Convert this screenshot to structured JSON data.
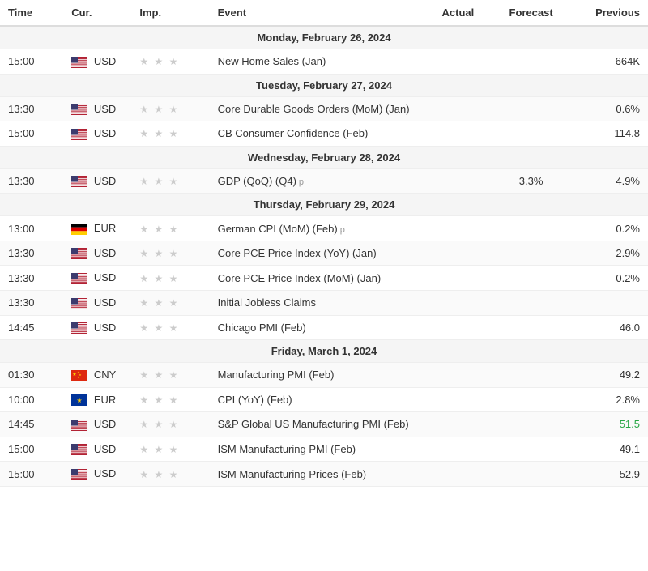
{
  "header": {
    "columns": [
      "Time",
      "Cur.",
      "Imp.",
      "Event",
      "Actual",
      "Forecast",
      "Previous"
    ]
  },
  "days": [
    {
      "label": "Monday, February 26, 2024",
      "rows": [
        {
          "time": "15:00",
          "currency": "USD",
          "flag": "us",
          "stars": "★ ★ ★",
          "event": "New Home Sales (Jan)",
          "actual": "",
          "forecast": "",
          "previous": "664K",
          "previous_green": false,
          "preliminary": false
        }
      ]
    },
    {
      "label": "Tuesday, February 27, 2024",
      "rows": [
        {
          "time": "13:30",
          "currency": "USD",
          "flag": "us",
          "stars": "★ ★ ★",
          "event": "Core Durable Goods Orders (MoM) (Jan)",
          "actual": "",
          "forecast": "",
          "previous": "0.6%",
          "previous_green": false,
          "preliminary": false
        },
        {
          "time": "15:00",
          "currency": "USD",
          "flag": "us",
          "stars": "★ ★ ★",
          "event": "CB Consumer Confidence (Feb)",
          "actual": "",
          "forecast": "",
          "previous": "114.8",
          "previous_green": false,
          "preliminary": false
        }
      ]
    },
    {
      "label": "Wednesday, February 28, 2024",
      "rows": [
        {
          "time": "13:30",
          "currency": "USD",
          "flag": "us",
          "stars": "★ ★ ★",
          "event": "GDP (QoQ) (Q4)",
          "actual": "",
          "forecast": "3.3%",
          "previous": "4.9%",
          "previous_green": false,
          "preliminary": true
        }
      ]
    },
    {
      "label": "Thursday, February 29, 2024",
      "rows": [
        {
          "time": "13:00",
          "currency": "EUR",
          "flag": "de",
          "stars": "★ ★ ★",
          "event": "German CPI (MoM) (Feb)",
          "actual": "",
          "forecast": "",
          "previous": "0.2%",
          "previous_green": false,
          "preliminary": true
        },
        {
          "time": "13:30",
          "currency": "USD",
          "flag": "us",
          "stars": "★ ★ ★",
          "event": "Core PCE Price Index (YoY) (Jan)",
          "actual": "",
          "forecast": "",
          "previous": "2.9%",
          "previous_green": false,
          "preliminary": false
        },
        {
          "time": "13:30",
          "currency": "USD",
          "flag": "us",
          "stars": "★ ★ ★",
          "event": "Core PCE Price Index (MoM) (Jan)",
          "actual": "",
          "forecast": "",
          "previous": "0.2%",
          "previous_green": false,
          "preliminary": false
        },
        {
          "time": "13:30",
          "currency": "USD",
          "flag": "us",
          "stars": "★ ★ ★",
          "event": "Initial Jobless Claims",
          "actual": "",
          "forecast": "",
          "previous": "",
          "previous_green": false,
          "preliminary": false
        },
        {
          "time": "14:45",
          "currency": "USD",
          "flag": "us",
          "stars": "★ ★ ★",
          "event": "Chicago PMI (Feb)",
          "actual": "",
          "forecast": "",
          "previous": "46.0",
          "previous_green": false,
          "preliminary": false
        }
      ]
    },
    {
      "label": "Friday, March 1, 2024",
      "rows": [
        {
          "time": "01:30",
          "currency": "CNY",
          "flag": "cn",
          "stars": "★ ★ ★",
          "event": "Manufacturing PMI (Feb)",
          "actual": "",
          "forecast": "",
          "previous": "49.2",
          "previous_green": false,
          "preliminary": false
        },
        {
          "time": "10:00",
          "currency": "EUR",
          "flag": "eu",
          "stars": "★ ★ ★",
          "event": "CPI (YoY) (Feb)",
          "actual": "",
          "forecast": "",
          "previous": "2.8%",
          "previous_green": false,
          "preliminary": false
        },
        {
          "time": "14:45",
          "currency": "USD",
          "flag": "us",
          "stars": "★ ★ ★",
          "event": "S&P Global US Manufacturing PMI (Feb)",
          "actual": "",
          "forecast": "",
          "previous": "51.5",
          "previous_green": true,
          "preliminary": false
        },
        {
          "time": "15:00",
          "currency": "USD",
          "flag": "us",
          "stars": "★ ★ ★",
          "event": "ISM Manufacturing PMI (Feb)",
          "actual": "",
          "forecast": "",
          "previous": "49.1",
          "previous_green": false,
          "preliminary": false
        },
        {
          "time": "15:00",
          "currency": "USD",
          "flag": "us",
          "stars": "★ ★ ★",
          "event": "ISM Manufacturing Prices (Feb)",
          "actual": "",
          "forecast": "",
          "previous": "52.9",
          "previous_green": false,
          "preliminary": false
        }
      ]
    }
  ]
}
